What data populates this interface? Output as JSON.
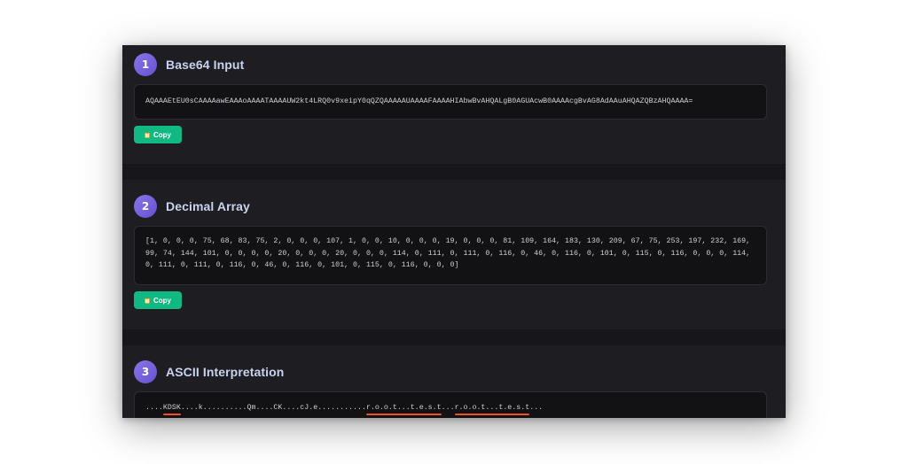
{
  "sections": [
    {
      "number": "1",
      "title": "Base64 Input",
      "content": "AQAAAEtEU0sCAAAAawEAAAoAAAATAAAAUW2kt4LRQ0v9xeipY0qQZQAAAAAUAAAAFAAAAHIAbwBvAHQALgB0AGUAcwB0AAAAcgBvAG8AdAAuAHQAZQBzAHQAAAA=",
      "copy_label": "Copy"
    },
    {
      "number": "2",
      "title": "Decimal Array",
      "content": "[1, 0, 0, 0, 75, 68, 83, 75, 2, 0, 0, 0, 107, 1, 0, 0, 10, 0, 0, 0, 19, 0, 0, 0, 81, 109, 164, 183, 130, 209, 67, 75, 253, 197, 232, 169, 99, 74, 144, 101, 0, 0, 0, 0, 20, 0, 0, 0, 20, 0, 0, 0, 114, 0, 111, 0, 111, 0, 116, 0, 46, 0, 116, 0, 101, 0, 115, 0, 116, 0, 0, 0, 114, 0, 111, 0, 111, 0, 116, 0, 46, 0, 116, 0, 101, 0, 115, 0, 116, 0, 0, 0]",
      "copy_label": "Copy"
    },
    {
      "number": "3",
      "title": "ASCII Interpretation",
      "ascii": {
        "p1": "....",
        "h1": "KDSK",
        "p2": "....k..........Qm....CK....cJ.e...........",
        "h2": "r.o.o.t...t.e.s.t",
        "p3": "...",
        "h3": "r.o.o.t...t.e.s.t",
        "p4": "..."
      }
    }
  ],
  "icons": {
    "copy": "clipboard-icon"
  },
  "colors": {
    "accent_badge": "#7b62e0",
    "copy_button": "#10b981",
    "highlight_underline": "#f25022"
  }
}
